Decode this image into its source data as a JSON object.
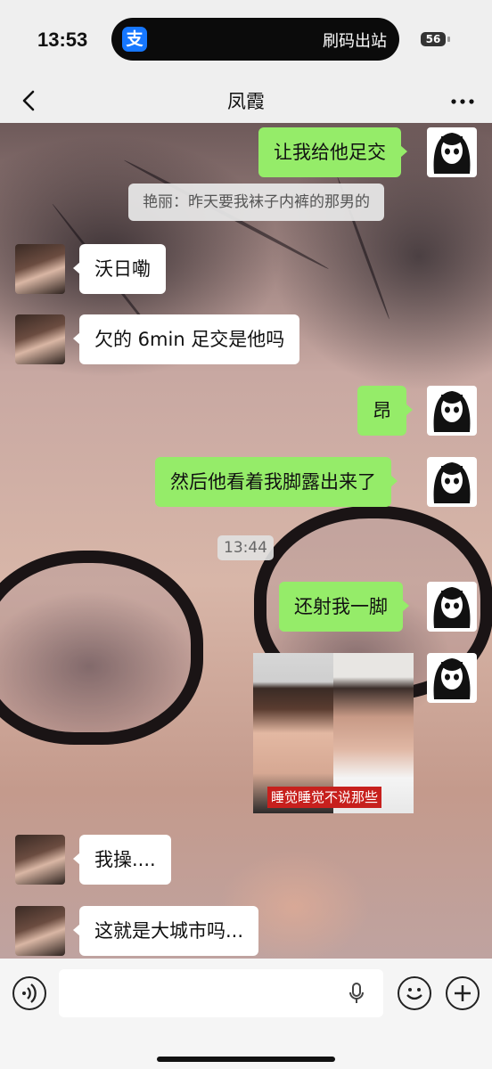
{
  "status_bar": {
    "time": "13:53",
    "island_app_icon": "alipay-icon",
    "island_app_glyph": "支",
    "island_text": "刷码出站",
    "battery_level": "56"
  },
  "nav": {
    "title": "凤霞",
    "back_icon": "chevron-left-icon",
    "more_icon": "more-dots-icon"
  },
  "messages": [
    {
      "side": "right",
      "text": "让我给他足交"
    },
    {
      "side": "quote",
      "text": "艳丽：昨天要我袜子内裤的那男的"
    },
    {
      "side": "left",
      "text": "沃日嘞"
    },
    {
      "side": "left",
      "text": "欠的 6min 足交是他吗"
    },
    {
      "side": "right",
      "text": "昂"
    },
    {
      "side": "right",
      "text": "然后他看着我脚露出来了"
    },
    {
      "side": "timestamp",
      "text": "13:44"
    },
    {
      "side": "right",
      "text": "还射我一脚"
    },
    {
      "side": "right-image",
      "caption": "睡觉睡觉不说那些"
    },
    {
      "side": "left",
      "text": "我操...."
    },
    {
      "side": "left",
      "text": "这就是大城市吗..."
    }
  ],
  "input_bar": {
    "voice_icon": "voice-icon",
    "mic_icon": "microphone-icon",
    "emoji_icon": "emoji-icon",
    "add_icon": "plus-icon"
  },
  "colors": {
    "sent_bubble": "#95ec69",
    "received_bubble": "#ffffff",
    "caption_bg": "#c7201d"
  }
}
